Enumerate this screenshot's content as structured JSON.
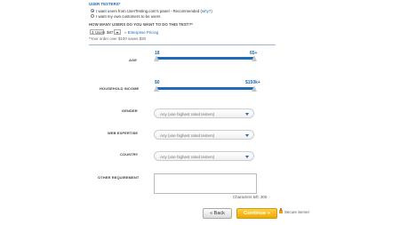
{
  "header": {
    "title": "USER TESTERS*",
    "option_panel": "I want users from UserTesting.com's panel - Recommended (",
    "option_panel_link": "why?",
    "option_panel_end": ")",
    "option_own": "I want my own customers to be users"
  },
  "users": {
    "question": "HOW MANY USERS DO YOU WANT TO DO THIS TEST?*",
    "count": "3",
    "unit": "Users",
    "price": "$87",
    "enterprise_link": "Enterprise Pricing",
    "promo": "*Your order over $100 saves $30"
  },
  "age": {
    "label": "AGE",
    "min": "18",
    "max": "65+",
    "low_fraction": 0.0,
    "high_fraction": 1.0
  },
  "income": {
    "label": "HOUSEHOLD INCOME",
    "min": "$0",
    "max": "$150k+",
    "low_fraction": 0.0,
    "high_fraction": 1.0
  },
  "gender": {
    "label": "GENDER",
    "value": "Any (use highest rated testers)"
  },
  "web_expertise": {
    "label": "WEB EXPERTISE",
    "value": "Any (use highest rated testers)"
  },
  "country": {
    "label": "COUNTRY",
    "value": "Any (use highest rated testers)"
  },
  "other": {
    "label": "OTHER REQUIREMENT",
    "value": "",
    "chars_left": "Characters left: 300"
  },
  "footer": {
    "back": "« Back",
    "continue": "Continue »",
    "secure": "Secure Server"
  },
  "colors": {
    "accent": "#1e6bb8",
    "continue": "#f0a800"
  }
}
